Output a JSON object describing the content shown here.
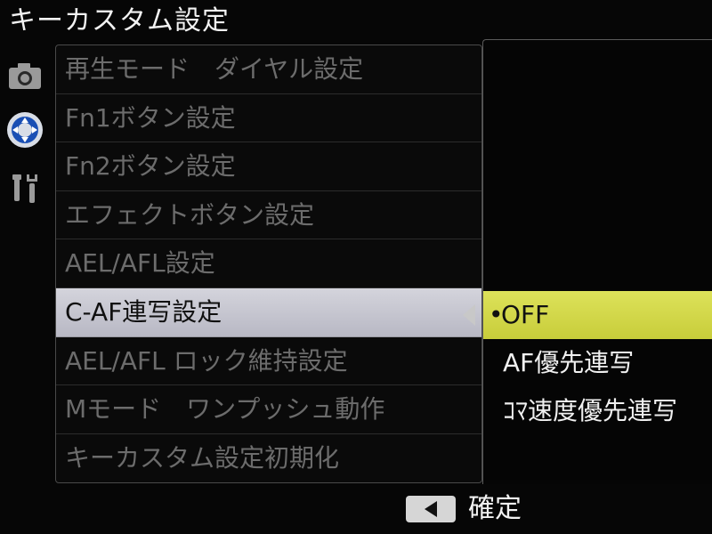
{
  "header": {
    "title": "キーカスタム設定"
  },
  "sidebar": {
    "icons": [
      "camera-icon",
      "dpad-icon",
      "wrench-screwdriver-icon"
    ]
  },
  "menu": {
    "items": [
      {
        "label": "再生モード　ダイヤル設定"
      },
      {
        "label": "Fn1ボタン設定"
      },
      {
        "label": "Fn2ボタン設定"
      },
      {
        "label": "エフェクトボタン設定"
      },
      {
        "label": "AEL/AFL設定"
      },
      {
        "label": "C-AF連写設定"
      },
      {
        "label": "AEL/AFL ロック維持設定"
      },
      {
        "label": "Mモード　ワンプッシュ動作"
      },
      {
        "label": "キーカスタム設定初期化"
      }
    ],
    "selected_index": 5
  },
  "options": {
    "items": [
      {
        "label": "OFF"
      },
      {
        "label": "AF優先連写"
      },
      {
        "label": "ｺﾏ速度優先連写"
      }
    ],
    "selected_index": 0,
    "bullet": "•"
  },
  "footer": {
    "key_icon": "left-arrow-key-icon",
    "confirm_label": "確定"
  },
  "colors": {
    "menu_highlight": "#c8c8d0",
    "option_highlight": "#d4d84a",
    "dim_text": "#6c6c6c",
    "bright_text": "#f0f0f0"
  }
}
